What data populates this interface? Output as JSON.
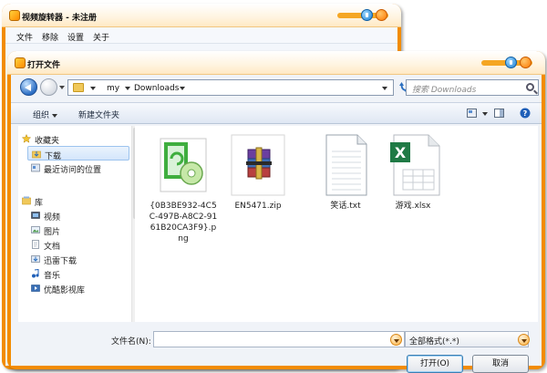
{
  "main_window": {
    "title": "视频旋转器 - 未注册",
    "menu": [
      "文件",
      "移除",
      "设置",
      "关于"
    ]
  },
  "dialog": {
    "title": "打开文件",
    "breadcrumb": [
      "my",
      "Downloads"
    ],
    "search_placeholder": "搜索 Downloads",
    "toolbar": {
      "organize": "组织",
      "new_folder": "新建文件夹"
    },
    "nav": {
      "favorites": "收藏夹",
      "downloads": "下载",
      "recent": "最近访问的位置",
      "libraries": "库",
      "videos": "视频",
      "pictures": "图片",
      "documents": "文档",
      "xunlei": "迅雷下载",
      "music": "音乐",
      "youku": "优酷影视库"
    },
    "files": [
      {
        "name": "{0B3BE932-4C5C-497B-A8C2-9161B20CA3F9}.png",
        "icon": "png-image-icon"
      },
      {
        "name": "EN5471.zip",
        "icon": "winrar-archive-icon"
      },
      {
        "name": "笑话.txt",
        "icon": "text-file-icon"
      },
      {
        "name": "游戏.xlsx",
        "icon": "excel-file-icon"
      }
    ],
    "filename_label": "文件名(N):",
    "filename_value": "",
    "filetype": "全部格式(*.*)",
    "open_button": "打开(O)",
    "cancel_button": "取消"
  },
  "colors": {
    "frame": "#f28c00",
    "accent_blue": "#1b7fd1",
    "selection": "#d4e6fb"
  }
}
